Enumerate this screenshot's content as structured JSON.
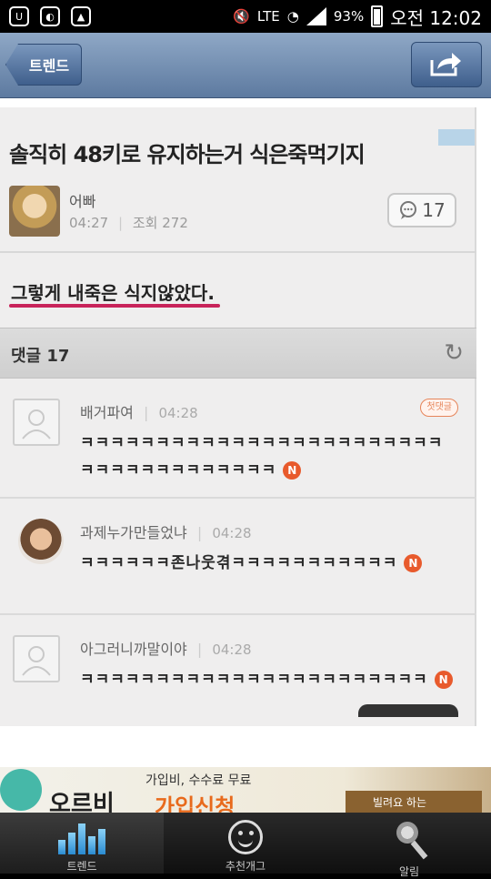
{
  "status_bar": {
    "wifi_label": "LTE",
    "battery": "93%",
    "time": "오전 12:02"
  },
  "nav": {
    "back_label": "트렌드"
  },
  "post": {
    "title": "솔직히 48키로 유지하는거 식은죽먹기지",
    "author": "어빠",
    "time": "04:27",
    "views_label": "조회 272",
    "comment_count": "17",
    "body": "그렇게 내죽은 식지않았다."
  },
  "comments_header": {
    "label": "댓글",
    "count": "17"
  },
  "comments": [
    {
      "author": "배거파여",
      "time": "04:28",
      "text": "ㅋㅋㅋㅋㅋㅋㅋㅋㅋㅋㅋㅋㅋㅋㅋㅋㅋㅋㅋㅋㅋㅋㅋㅋㅋㅋㅋㅋㅋㅋㅋㅋㅋㅋㅋㅋㅋ",
      "badge": "첫댓글",
      "new_badge": "N"
    },
    {
      "author": "과제누가만들었냐",
      "time": "04:28",
      "text": "ㅋㅋㅋㅋㅋㅋ존나웃겪ㅋㅋㅋㅋㅋㅋㅋㅋㅋㅋㅋ",
      "new_badge": "N"
    },
    {
      "author": "아그러니까말이야",
      "time": "04:28",
      "text": "ㅋㅋㅋㅋㅋㅋㅋㅋㅋㅋㅋㅋㅋㅋㅋㅋㅋㅋㅋㅋㅋㅋㅋ",
      "new_badge": "N"
    }
  ],
  "banner": {
    "brand": "오르비",
    "sub": "가입비, 수수료 무료",
    "main": "가입신청",
    "right": "빌려요 하는"
  },
  "tabs": [
    {
      "label": "트렌드",
      "active": true
    },
    {
      "label": "추천개그",
      "active": false
    },
    {
      "label": "알림",
      "active": false
    }
  ],
  "colors": {
    "navbar": "#6d89ae",
    "underline": "#c8235a",
    "new_badge": "#e85a2c",
    "tab_active_icon": "#4aaee6"
  }
}
